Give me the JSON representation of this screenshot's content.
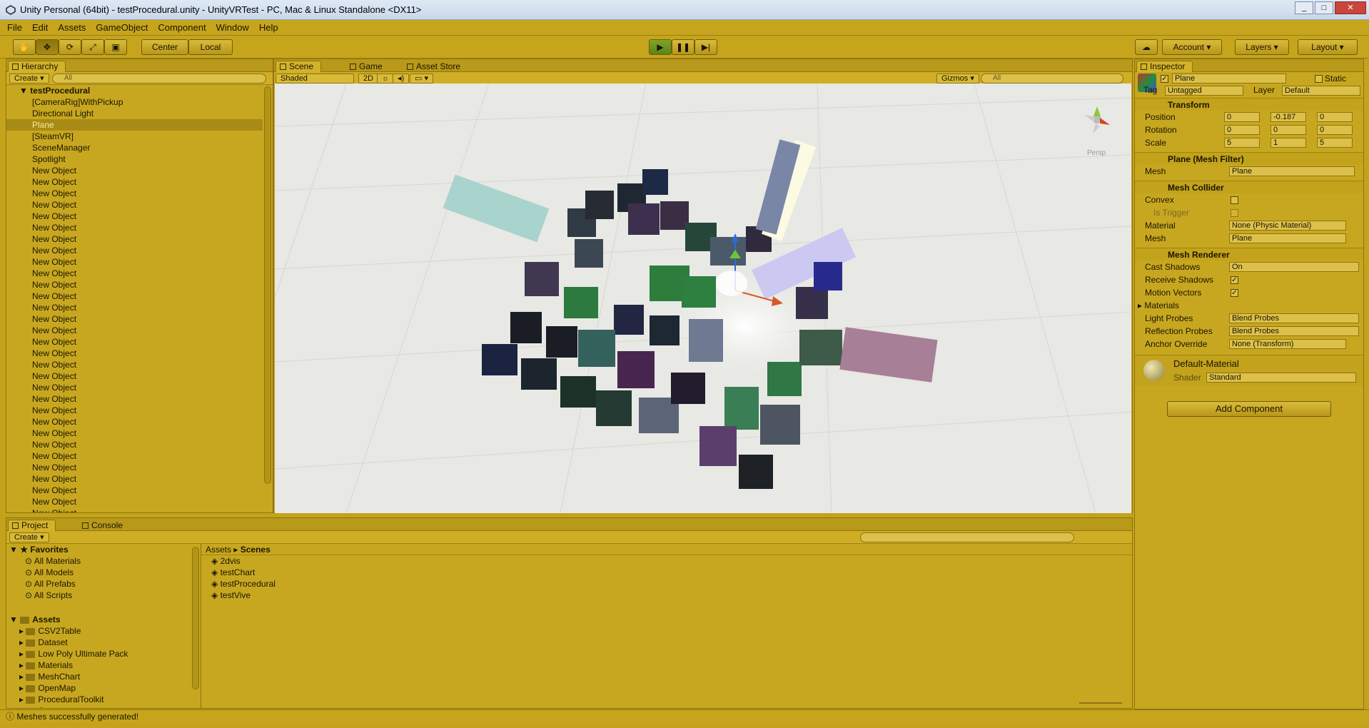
{
  "window": {
    "title": "Unity Personal (64bit) - testProcedural.unity - UnityVRTest - PC, Mac & Linux Standalone <DX11>"
  },
  "menu": [
    "File",
    "Edit",
    "Assets",
    "GameObject",
    "Component",
    "Window",
    "Help"
  ],
  "toolbar": {
    "pivot": "Center",
    "space": "Local",
    "account": "Account",
    "layers": "Layers",
    "layout": "Layout"
  },
  "hierarchy": {
    "tab": "Hierarchy",
    "create": "Create",
    "search_placeholder": "All",
    "scene": "testProcedural",
    "items": [
      "[CameraRig]WithPickup",
      "Directional Light",
      "Plane",
      "[SteamVR]",
      "SceneManager",
      "Spotlight",
      "New Object",
      "New Object",
      "New Object",
      "New Object",
      "New Object",
      "New Object",
      "New Object",
      "New Object",
      "New Object",
      "New Object",
      "New Object",
      "New Object",
      "New Object",
      "New Object",
      "New Object",
      "New Object",
      "New Object",
      "New Object",
      "New Object",
      "New Object",
      "New Object",
      "New Object",
      "New Object",
      "New Object",
      "New Object",
      "New Object",
      "New Object",
      "New Object",
      "New Object",
      "New Object",
      "New Object"
    ],
    "selected_index": 2
  },
  "scene": {
    "tabs": [
      "Scene",
      "Game",
      "Asset Store"
    ],
    "shading": "Shaded",
    "mode2d": "2D",
    "gizmos": "Gizmos",
    "search_placeholder": "All",
    "persp": "Persp"
  },
  "inspector": {
    "tab": "Inspector",
    "name": "Plane",
    "static": "Static",
    "tag_label": "Tag",
    "tag": "Untagged",
    "layer_label": "Layer",
    "layer": "Default",
    "transform": {
      "title": "Transform",
      "position_label": "Position",
      "rotation_label": "Rotation",
      "scale_label": "Scale",
      "position": [
        "0",
        "-0.187",
        "0"
      ],
      "rotation": [
        "0",
        "0",
        "0"
      ],
      "scale": [
        "5",
        "1",
        "5"
      ]
    },
    "mesh_filter": {
      "title": "Plane (Mesh Filter)",
      "mesh_label": "Mesh",
      "mesh": "Plane"
    },
    "mesh_collider": {
      "title": "Mesh Collider",
      "convex": "Convex",
      "is_trigger": "Is Trigger",
      "material_label": "Material",
      "material": "None (Physic Material)",
      "mesh_label": "Mesh",
      "mesh": "Plane"
    },
    "mesh_renderer": {
      "title": "Mesh Renderer",
      "cast_shadows_label": "Cast Shadows",
      "cast_shadows": "On",
      "receive_shadows": "Receive Shadows",
      "motion_vectors": "Motion Vectors",
      "materials": "Materials",
      "light_probes_label": "Light Probes",
      "light_probes": "Blend Probes",
      "reflection_probes_label": "Reflection Probes",
      "reflection_probes": "Blend Probes",
      "anchor_override_label": "Anchor Override",
      "anchor_override": "None (Transform)"
    },
    "material": {
      "name": "Default-Material",
      "shader_label": "Shader",
      "shader": "Standard"
    },
    "add_component": "Add Component"
  },
  "project": {
    "tabs": [
      "Project",
      "Console"
    ],
    "create": "Create",
    "favorites_title": "Favorites",
    "favorites": [
      "All Materials",
      "All Models",
      "All Prefabs",
      "All Scripts"
    ],
    "assets_title": "Assets",
    "folders": [
      "CSV2Table",
      "Dataset",
      "Low Poly Ultimate Pack",
      "Materials",
      "MeshChart",
      "OpenMap",
      "ProceduralToolkit",
      "Scenes"
    ],
    "breadcrumb": [
      "Assets",
      "Scenes"
    ],
    "files": [
      "2dvis",
      "testChart",
      "testProcedural",
      "testVive"
    ]
  },
  "status": "Meshes successfully generated!"
}
